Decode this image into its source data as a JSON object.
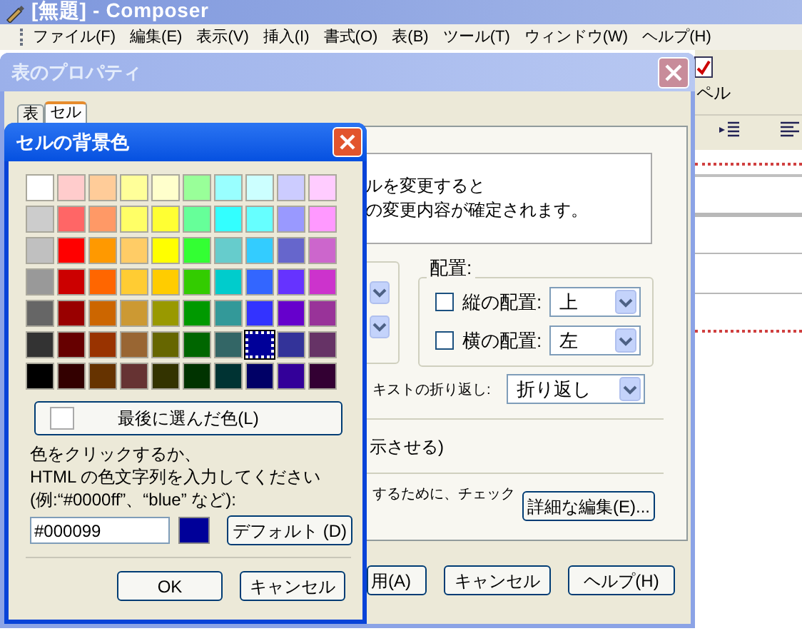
{
  "app": {
    "title": "[無題] - Composer",
    "menu": [
      "ファイル(F)",
      "編集(E)",
      "表示(V)",
      "挿入(I)",
      "書式(O)",
      "表(B)",
      "ツール(T)",
      "ウィンドウ(W)",
      "ヘルプ(H)"
    ],
    "toolbar_label": "ペル"
  },
  "table_properties": {
    "title": "表のプロパティ",
    "tabs": [
      {
        "label": "表",
        "selected": false
      },
      {
        "label": "セル",
        "selected": true
      }
    ],
    "info_lines": [
      "ルを変更すると",
      "の変更内容が確定されます。"
    ],
    "alignment": {
      "title": "配置:",
      "rows": [
        {
          "label": "縦の配置:",
          "checked": false,
          "value": "上"
        },
        {
          "label": "横の配置:",
          "checked": false,
          "value": "左"
        }
      ]
    },
    "wrap": {
      "label": "キストの折り返し:",
      "value": "折り返し"
    },
    "note_1": "示させる)",
    "note_2": "するために、チェック",
    "advanced_button": "詳細な編集(E)...",
    "buttons": [
      "用(A)",
      "キャンセル",
      "ヘルプ(H)"
    ]
  },
  "color_dialog": {
    "title": "セルの背景色",
    "swatches": [
      [
        {
          "color": "#ffffff",
          "selected": false
        },
        {
          "color": "#ffcccc",
          "selected": false
        },
        {
          "color": "#ffcc99",
          "selected": false
        },
        {
          "color": "#ffff99",
          "selected": false
        },
        {
          "color": "#ffffcc",
          "selected": false
        },
        {
          "color": "#99ff99",
          "selected": false
        },
        {
          "color": "#99ffff",
          "selected": false
        },
        {
          "color": "#ccffff",
          "selected": false
        },
        {
          "color": "#ccccff",
          "selected": false
        },
        {
          "color": "#ffccff",
          "selected": false
        }
      ],
      [
        {
          "color": "#cccccc",
          "selected": false
        },
        {
          "color": "#ff6666",
          "selected": false
        },
        {
          "color": "#ff9966",
          "selected": false
        },
        {
          "color": "#ffff66",
          "selected": false
        },
        {
          "color": "#ffff33",
          "selected": false
        },
        {
          "color": "#66ff99",
          "selected": false
        },
        {
          "color": "#33ffff",
          "selected": false
        },
        {
          "color": "#66ffff",
          "selected": false
        },
        {
          "color": "#9999ff",
          "selected": false
        },
        {
          "color": "#ff99ff",
          "selected": false
        }
      ],
      [
        {
          "color": "#c0c0c0",
          "selected": false
        },
        {
          "color": "#ff0000",
          "selected": false
        },
        {
          "color": "#ff9900",
          "selected": false
        },
        {
          "color": "#ffcc66",
          "selected": false
        },
        {
          "color": "#ffff00",
          "selected": false
        },
        {
          "color": "#33ff33",
          "selected": false
        },
        {
          "color": "#66cccc",
          "selected": false
        },
        {
          "color": "#33ccff",
          "selected": false
        },
        {
          "color": "#6666cc",
          "selected": false
        },
        {
          "color": "#cc66cc",
          "selected": false
        }
      ],
      [
        {
          "color": "#999999",
          "selected": false
        },
        {
          "color": "#cc0000",
          "selected": false
        },
        {
          "color": "#ff6600",
          "selected": false
        },
        {
          "color": "#ffcc33",
          "selected": false
        },
        {
          "color": "#ffcc00",
          "selected": false
        },
        {
          "color": "#33cc00",
          "selected": false
        },
        {
          "color": "#00cccc",
          "selected": false
        },
        {
          "color": "#3366ff",
          "selected": false
        },
        {
          "color": "#6633ff",
          "selected": false
        },
        {
          "color": "#cc33cc",
          "selected": false
        }
      ],
      [
        {
          "color": "#666666",
          "selected": false
        },
        {
          "color": "#990000",
          "selected": false
        },
        {
          "color": "#cc6600",
          "selected": false
        },
        {
          "color": "#cc9933",
          "selected": false
        },
        {
          "color": "#999900",
          "selected": false
        },
        {
          "color": "#009900",
          "selected": false
        },
        {
          "color": "#339999",
          "selected": false
        },
        {
          "color": "#3333ff",
          "selected": false
        },
        {
          "color": "#6600cc",
          "selected": false
        },
        {
          "color": "#993399",
          "selected": false
        }
      ],
      [
        {
          "color": "#333333",
          "selected": false
        },
        {
          "color": "#660000",
          "selected": false
        },
        {
          "color": "#993300",
          "selected": false
        },
        {
          "color": "#996633",
          "selected": false
        },
        {
          "color": "#666600",
          "selected": false
        },
        {
          "color": "#006600",
          "selected": false
        },
        {
          "color": "#336666",
          "selected": false
        },
        {
          "color": "#000099",
          "selected": true
        },
        {
          "color": "#333399",
          "selected": false
        },
        {
          "color": "#663366",
          "selected": false
        }
      ],
      [
        {
          "color": "#000000",
          "selected": false
        },
        {
          "color": "#330000",
          "selected": false
        },
        {
          "color": "#663300",
          "selected": false
        },
        {
          "color": "#663333",
          "selected": false
        },
        {
          "color": "#333300",
          "selected": false
        },
        {
          "color": "#003300",
          "selected": false
        },
        {
          "color": "#003333",
          "selected": false
        },
        {
          "color": "#000066",
          "selected": false
        },
        {
          "color": "#330099",
          "selected": false
        },
        {
          "color": "#330033",
          "selected": false
        }
      ]
    ],
    "last_color": {
      "label": "最後に選んだ色(L)",
      "color": "#ffffff"
    },
    "instructions": [
      "色をクリックするか、",
      "HTML の色文字列を入力してください",
      "(例:“#0000ff”、“blue” など):"
    ],
    "value": "#000099",
    "default_button": "デフォルト (D)",
    "buttons": [
      "OK",
      "キャンセル"
    ]
  }
}
